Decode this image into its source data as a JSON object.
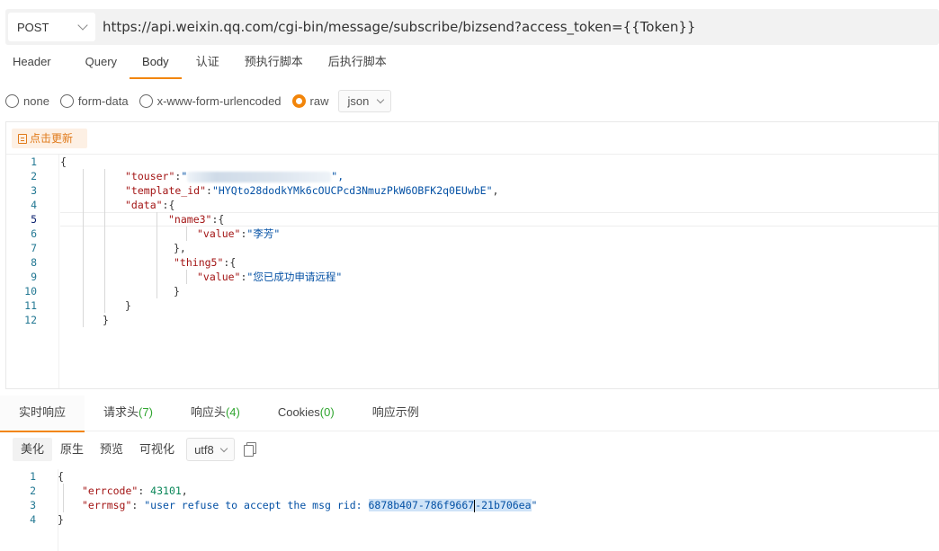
{
  "request": {
    "method": "POST",
    "url": "https://api.weixin.qq.com/cgi-bin/message/subscribe/bizsend?access_token={{Token}}"
  },
  "tabs": [
    "Header",
    "Query",
    "Body",
    "认证",
    "预执行脚本",
    "后执行脚本"
  ],
  "active_tab": "Body",
  "body_modes": [
    "none",
    "form-data",
    "x-www-form-urlencoded",
    "raw"
  ],
  "active_body_mode": "raw",
  "format_select": "json",
  "update_button": "点击更新",
  "request_code": {
    "line_numbers": [
      "1",
      "2",
      "3",
      "4",
      "5",
      "6",
      "7",
      "8",
      "9",
      "10",
      "11",
      "12"
    ],
    "open_brace": "{",
    "touser_key": "\"touser\"",
    "touser_value_start": "\"",
    "touser_value_end": "\",",
    "template_id_key": "\"template_id\"",
    "template_id_value": "\"HYQto28dodkYMk6cOUCPcd3NmuzPkW6OBFK2q0EUwbE\"",
    "data_key": "\"data\"",
    "name3_key": "\"name3\"",
    "name3_value_key": "\"value\"",
    "name3_value": "\"李芳\"",
    "thing5_key": "\"thing5\"",
    "thing5_value_key": "\"value\"",
    "thing5_value": "\"您已成功申请远程\"",
    "close_inner_comma": "},",
    "close_inner": "}",
    "close_data": "}",
    "close_outer": "}"
  },
  "response_tabs": [
    {
      "label": "实时响应",
      "count": ""
    },
    {
      "label": "请求头",
      "count": "(7)"
    },
    {
      "label": "响应头",
      "count": "(4)"
    },
    {
      "label": "Cookies",
      "count": "(0)"
    },
    {
      "label": "响应示例",
      "count": ""
    }
  ],
  "response_view_modes": [
    "美化",
    "原生",
    "预览",
    "可视化"
  ],
  "response_encoding": "utf8",
  "response_code": {
    "line_numbers": [
      "1",
      "2",
      "3",
      "4"
    ],
    "open_brace": "{",
    "errcode_key": "\"errcode\"",
    "errcode_value": "43101",
    "errmsg_key": "\"errmsg\"",
    "errmsg_prefix": "\"user refuse to accept the msg rid: ",
    "errmsg_selected_a": "6878b407-786f9667",
    "errmsg_selected_b": "-21b706ea",
    "errmsg_suffix": "\"",
    "close_brace": "}"
  },
  "colors": {
    "accent": "#f2850a",
    "json_key": "#a31515",
    "json_string": "#0451a5",
    "json_number": "#098658",
    "count": "#2fa52f"
  }
}
